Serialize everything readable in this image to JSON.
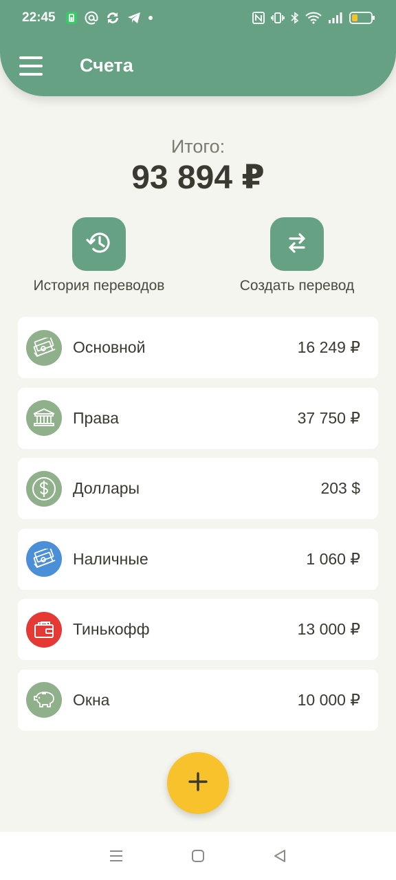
{
  "status_bar": {
    "time": "22:45",
    "left_icons": [
      "battery-saver-icon",
      "at-icon",
      "sync-app-icon",
      "telegram-icon",
      "dot-icon"
    ],
    "right_icons": [
      "nfc-icon",
      "vibrate-icon",
      "bluetooth-icon",
      "wifi-icon",
      "signal-icon",
      "battery-icon"
    ]
  },
  "header": {
    "title": "Счета",
    "menu_icon": "hamburger-icon"
  },
  "total": {
    "label": "Итого:",
    "value": "93 894 ₽"
  },
  "actions": [
    {
      "label": "История переводов",
      "icon": "history-icon"
    },
    {
      "label": "Создать перевод",
      "icon": "transfer-icon"
    }
  ],
  "accounts": [
    {
      "name": "Основной",
      "amount": "16 249 ₽",
      "icon": "money-stack-icon",
      "color": "#8fb08a"
    },
    {
      "name": "Права",
      "amount": "37 750 ₽",
      "icon": "bank-icon",
      "color": "#8fb08a"
    },
    {
      "name": "Доллары",
      "amount": "203 $",
      "icon": "dollar-coin-icon",
      "color": "#8fb08a"
    },
    {
      "name": "Наличные",
      "amount": "1 060 ₽",
      "icon": "money-stack-icon",
      "color": "#4a8fd8"
    },
    {
      "name": "Тинькофф",
      "amount": "13 000 ₽",
      "icon": "wallet-icon",
      "color": "#e53935"
    },
    {
      "name": "Окна",
      "amount": "10 000 ₽",
      "icon": "piggy-bank-icon",
      "color": "#8fb08a"
    }
  ],
  "fab": {
    "icon": "plus-icon",
    "color": "#f8c22d"
  },
  "colors": {
    "header": "#66a184",
    "background": "#f5f5ef"
  },
  "navbar": {
    "icons": [
      "recent-apps-icon",
      "home-icon",
      "back-icon"
    ]
  }
}
